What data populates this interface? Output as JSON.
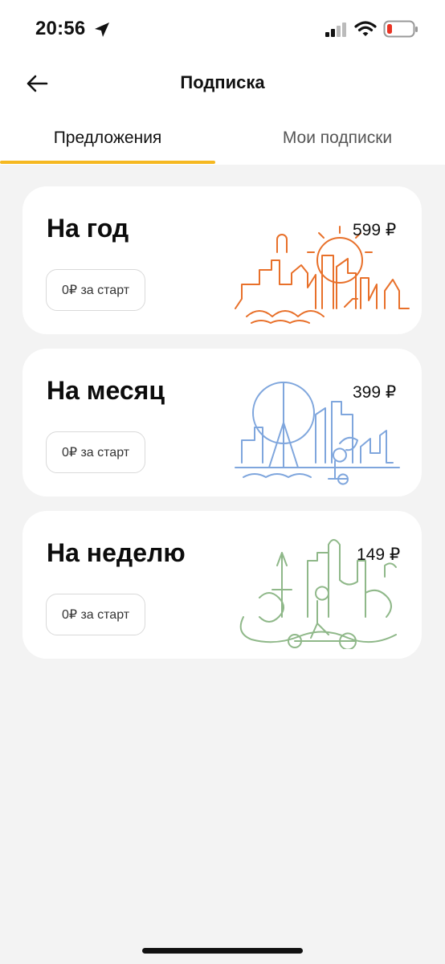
{
  "status_bar": {
    "time": "20:56"
  },
  "header": {
    "title": "Подписка"
  },
  "tabs": [
    {
      "label": "Предложения",
      "active": true
    },
    {
      "label": "Мои подписки",
      "active": false
    }
  ],
  "plans": [
    {
      "title": "На год",
      "price": "599 ₽",
      "button": "0₽ за старт",
      "illustration_color": "#e8702a"
    },
    {
      "title": "На месяц",
      "price": "399 ₽",
      "button": "0₽ за старт",
      "illustration_color": "#7fa6dd"
    },
    {
      "title": "На неделю",
      "price": "149 ₽",
      "button": "0₽ за старт",
      "illustration_color": "#8fb889"
    }
  ],
  "colors": {
    "accent": "#f5b820",
    "background": "#f3f3f3",
    "card": "#ffffff"
  }
}
